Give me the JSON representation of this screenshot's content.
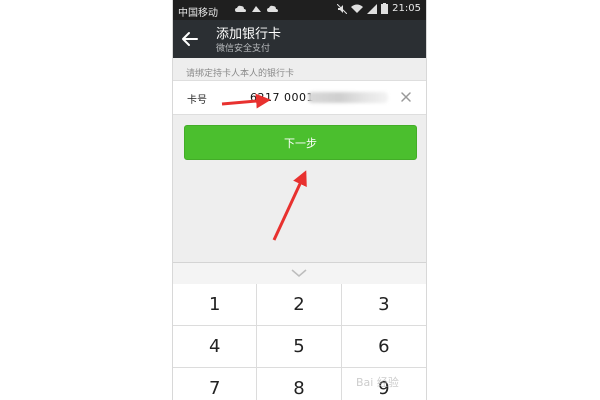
{
  "statusbar": {
    "carrier": "中国移动",
    "battery": "100",
    "time": "21:05"
  },
  "header": {
    "back_icon": "back-arrow-icon",
    "title": "添加银行卡",
    "subtitle": "微信安全支付"
  },
  "form": {
    "hint": "请绑定持卡人本人的银行卡",
    "card_label": "卡号",
    "card_value": "6217 0001",
    "clear_icon": "close-icon"
  },
  "next_button": {
    "label": "下一步",
    "color": "#4bbf2e"
  },
  "keyboard": {
    "collapse_icon": "chevron-down-icon",
    "keys": [
      "1",
      "2",
      "3",
      "4",
      "5",
      "6",
      "7",
      "8",
      "9"
    ]
  },
  "annotations": {
    "arrow_color": "#e8312f"
  },
  "watermark": "Bai 经验"
}
